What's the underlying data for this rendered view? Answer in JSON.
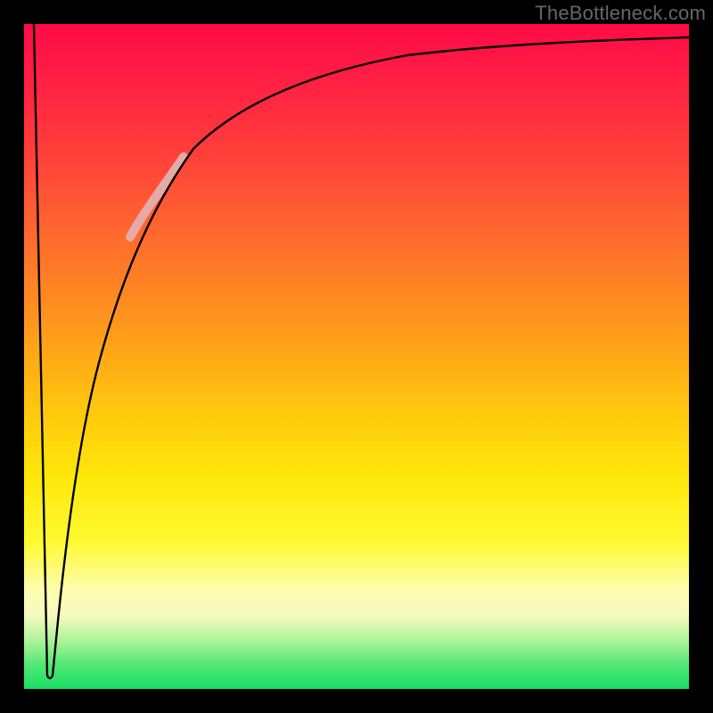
{
  "watermark": "TheBottleneck.com",
  "chart_data": {
    "type": "line",
    "title": "",
    "xlabel": "",
    "ylabel": "",
    "xlim": [
      0,
      100
    ],
    "ylim": [
      0,
      100
    ],
    "background_gradient_stops": [
      {
        "pos": 0,
        "color": "#ff0b46"
      },
      {
        "pos": 18,
        "color": "#ff3a3b"
      },
      {
        "pos": 46,
        "color": "#ff9a1a"
      },
      {
        "pos": 68,
        "color": "#ffe70a"
      },
      {
        "pos": 85,
        "color": "#fdfdad"
      },
      {
        "pos": 93,
        "color": "#a6f296"
      },
      {
        "pos": 100,
        "color": "#19de65"
      }
    ],
    "series": [
      {
        "name": "bottleneck-curve",
        "stroke": "#000000",
        "points": [
          {
            "x": 1.5,
            "y": 100
          },
          {
            "x": 3.5,
            "y": 2
          },
          {
            "x": 4.3,
            "y": 2
          },
          {
            "x": 6,
            "y": 20
          },
          {
            "x": 8,
            "y": 38
          },
          {
            "x": 10,
            "y": 50
          },
          {
            "x": 13,
            "y": 60
          },
          {
            "x": 17,
            "y": 70
          },
          {
            "x": 22,
            "y": 78
          },
          {
            "x": 30,
            "y": 85
          },
          {
            "x": 40,
            "y": 89.5
          },
          {
            "x": 55,
            "y": 92.5
          },
          {
            "x": 75,
            "y": 94.5
          },
          {
            "x": 100,
            "y": 96
          }
        ]
      },
      {
        "name": "highlight-segment",
        "stroke": "#e6a9a9",
        "stroke_width_px": 10,
        "x_range": [
          16,
          24
        ],
        "points": [
          {
            "x": 16,
            "y": 68
          },
          {
            "x": 24,
            "y": 80
          }
        ]
      }
    ]
  }
}
